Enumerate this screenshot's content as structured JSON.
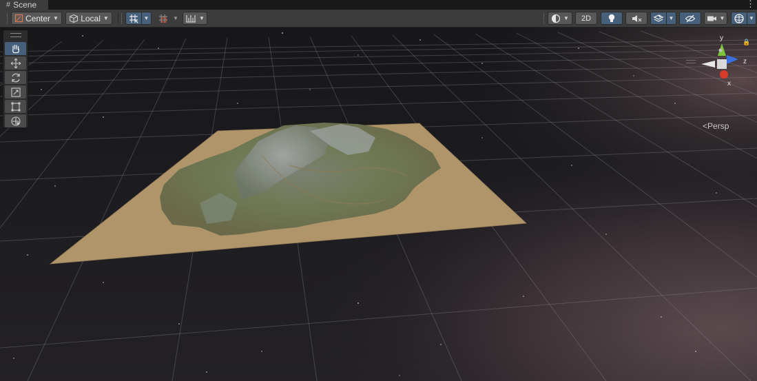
{
  "tab": {
    "title": "Scene",
    "icon": "grid-icon"
  },
  "toolbar": {
    "pivot_mode": "Center",
    "pivot_rotation": "Local",
    "view_2d": "2D"
  },
  "gizmo": {
    "y_label": "y",
    "z_label": "z",
    "x_label": "x",
    "projection": "Persp"
  },
  "tools": [
    "view-tool",
    "move-tool",
    "rotate-tool",
    "scale-tool",
    "rect-tool",
    "transform-tool"
  ],
  "colors": {
    "accent": "#46607c",
    "toolbar": "#3c3c3c",
    "button": "#585858",
    "sand": "#b0946a",
    "axis_x": "#d83a2a",
    "axis_y": "#7dc63a",
    "axis_z": "#3b6ee0"
  }
}
